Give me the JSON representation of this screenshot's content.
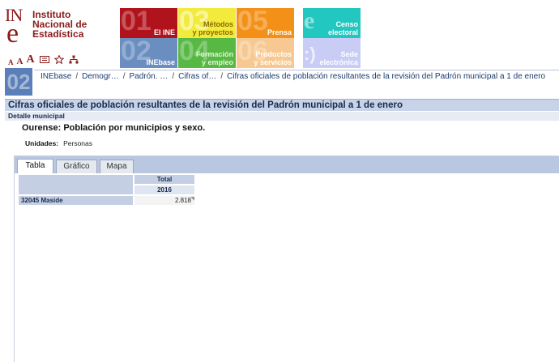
{
  "logo": {
    "mark_top": "IN",
    "mark_bottom": "e",
    "line1": "Instituto",
    "line2": "Nacional de",
    "line3": "Estadística"
  },
  "tools": {
    "font_small": "A",
    "font_medium": "A",
    "font_large": "A",
    "icons": [
      "contact-card-icon",
      "star-icon",
      "sitemap-icon"
    ]
  },
  "tiles": [
    {
      "num": "01",
      "label_1": "El INE",
      "label_2": "",
      "color": "#b0131c"
    },
    {
      "num": "03",
      "label_1": "Métodos",
      "label_2": "y proyectos",
      "color": "#f2eb3c"
    },
    {
      "num": "05",
      "label_1": "Prensa",
      "label_2": "",
      "color": "#f39018"
    },
    {
      "num": "02",
      "label_1": "INEbase",
      "label_2": "",
      "color": "#6a8ec0"
    },
    {
      "num": "04",
      "label_1": "Formación",
      "label_2": "y empleo",
      "color": "#58b844"
    },
    {
      "num": "06",
      "label_1": "Productos",
      "label_2": "y servicios",
      "color": "#f7c891"
    },
    {
      "num": "e",
      "label_1": "Censo",
      "label_2": "electoral",
      "color": "#22c7c0"
    },
    {
      "num": ":)",
      "label_1": "Sede",
      "label_2": "electrónica",
      "color": "#c9cdf5"
    }
  ],
  "breadcrumb": {
    "section_num": "02",
    "items": [
      "INEbase",
      "Demogr…",
      "Padrón. …",
      "Cifras of…",
      "Cifras oficiales de población resultantes de la revisión del Padrón municipal a 1 de enero"
    ],
    "separator": "/"
  },
  "page": {
    "title": "Cifras oficiales de población resultantes de la revisión del Padrón municipal a 1 de enero",
    "subtitle": "Detalle municipal",
    "table_title": "Ourense: Población por municipios y sexo.",
    "units_label": "Unidades:",
    "units_value": "Personas"
  },
  "tabs": [
    {
      "label": "Tabla",
      "active": true
    },
    {
      "label": "Gráfico",
      "active": false
    },
    {
      "label": "Mapa",
      "active": false
    }
  ],
  "table": {
    "column_header": "Total",
    "year": "2016",
    "rows": [
      {
        "label": "32045 Maside",
        "value": "2.818"
      }
    ]
  }
}
